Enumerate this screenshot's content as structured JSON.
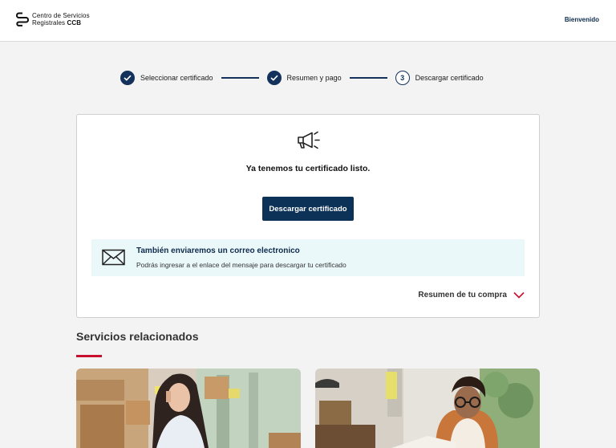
{
  "header": {
    "logo": {
      "line1": "Centro de Servicios",
      "line2_regular": "Registrales",
      "line2_bold": "CCB"
    },
    "welcome": "Bienvenido"
  },
  "stepper": {
    "steps": [
      {
        "label": "Seleccionar certificado",
        "state": "done"
      },
      {
        "label": "Resumen y pago",
        "state": "done"
      },
      {
        "label": "Descargar certificado",
        "state": "current",
        "number": "3"
      }
    ]
  },
  "result": {
    "icon": "megaphone-icon",
    "message": "Ya tenemos tu certificado listo.",
    "download_label": "Descargar certificado"
  },
  "notice": {
    "icon": "envelope-icon",
    "title": "También enviaremos un correo electronico",
    "text": "Podrás ingresar a el enlace del mensaje para descargar tu certificado"
  },
  "summary": {
    "label": "Resumen de tu compra",
    "icon": "chevron-down-icon"
  },
  "related": {
    "title": "Servicios relacionados",
    "cards": [
      {
        "image": "woman-on-phone-with-boxes-photo"
      },
      {
        "image": "woman-with-glasses-reading-photo"
      }
    ]
  },
  "colors": {
    "primary": "#0d3257",
    "accent": "#c8102e",
    "notice_bg": "#ebf8fa",
    "page_bg": "#f3f3f3"
  }
}
